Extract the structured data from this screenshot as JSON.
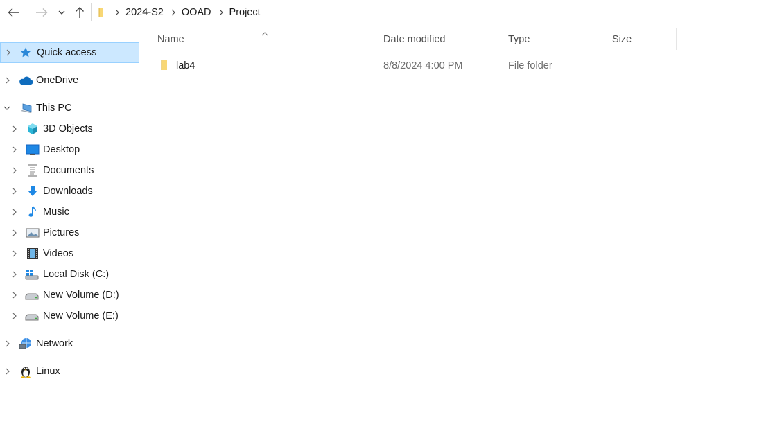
{
  "address_bar": {
    "crumbs": [
      "2024-S2",
      "OOAD",
      "Project"
    ]
  },
  "columns": {
    "name": "Name",
    "date_modified": "Date modified",
    "type": "Type",
    "size": "Size"
  },
  "files": [
    {
      "name": "lab4",
      "date_modified": "8/8/2024 4:00 PM",
      "type": "File folder",
      "size": ""
    }
  ],
  "nav": {
    "quick_access": "Quick access",
    "onedrive": "OneDrive",
    "this_pc": "This PC",
    "objects_3d": "3D Objects",
    "desktop": "Desktop",
    "documents": "Documents",
    "downloads": "Downloads",
    "music": "Music",
    "pictures": "Pictures",
    "videos": "Videos",
    "local_disk_c": "Local Disk (C:)",
    "new_volume_d": "New Volume (D:)",
    "new_volume_e": "New Volume (E:)",
    "network": "Network",
    "linux": "Linux"
  },
  "colors": {
    "selection_bg": "#cce8ff",
    "selection_border": "#99d1ff",
    "folder_yellow": "#f8d775",
    "header_text": "#4d4d4d"
  }
}
